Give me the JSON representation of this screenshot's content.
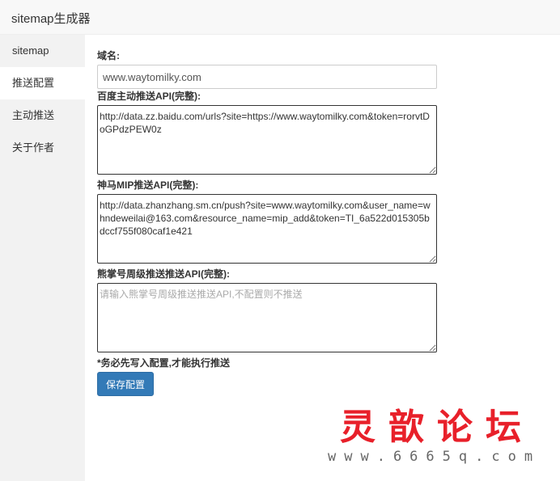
{
  "window": {
    "title": "sitemap生成器"
  },
  "sidebar": {
    "items": [
      {
        "label": "sitemap"
      },
      {
        "label": "推送配置"
      },
      {
        "label": "主动推送"
      },
      {
        "label": "关于作者"
      }
    ]
  },
  "form": {
    "domain": {
      "label": "域名:",
      "value": "www.waytomilky.com"
    },
    "baidu": {
      "label": "百度主动推送API(完整):",
      "value": "http://data.zz.baidu.com/urls?site=https://www.waytomilky.com&token=rorvtDoGPdzPEW0z"
    },
    "shenma": {
      "label": "神马MIP推送API(完整):",
      "value": "http://data.zhanzhang.sm.cn/push?site=www.waytomilky.com&user_name=whndeweilai@163.com&resource_name=mip_add&token=TI_6a522d015305bdccf755f080caf1e421"
    },
    "xiongzhang": {
      "label": "熊掌号周级推送推送API(完整):",
      "value": "",
      "placeholder": "请输入熊掌号周级推送推送API,不配置则不推送"
    },
    "note": "*务必先写入配置,才能执行推送",
    "save_label": "保存配置"
  },
  "watermark": {
    "title": "灵歆论坛",
    "url": "www.6665q.com"
  },
  "colors": {
    "primary_button": "#337ab7",
    "sidebar_bg": "#f2f2f2",
    "watermark_red": "#e8202a"
  }
}
